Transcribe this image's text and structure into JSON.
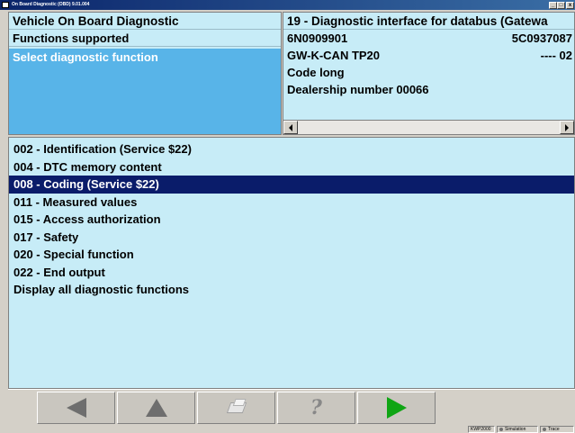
{
  "window": {
    "title": "On Board Diagnostic (OBD) 9.01.004",
    "min_label": "_",
    "max_label": "□",
    "close_label": "x"
  },
  "left_panel": {
    "title": "Vehicle On Board Diagnostic",
    "subtitle": "Functions supported",
    "selected": "Select diagnostic function"
  },
  "right_panel": {
    "title": "19 - Diagnostic interface for databus  (Gatewa",
    "rows": [
      {
        "left": "6N0909901",
        "right": "5C0937087"
      },
      {
        "left": "GW-K-CAN TP20",
        "right": "----  02"
      },
      {
        "left": "Code long",
        "right": ""
      },
      {
        "left": "Dealership number 00066",
        "right": ""
      }
    ]
  },
  "functions": {
    "items": [
      "002 - Identification (Service $22)",
      "004 - DTC memory content",
      "008 - Coding (Service $22)",
      "011 - Measured values",
      "015 - Access authorization",
      "017 - Safety",
      "020 - Special function",
      "022 - End output",
      "Display all diagnostic functions"
    ],
    "selected_index": 2
  },
  "toolbar": {
    "buttons": [
      "back-arrow-icon",
      "up-arrow-icon",
      "print-icon",
      "help-icon",
      "forward-arrow-icon"
    ],
    "help_glyph": "?"
  },
  "statusbar": {
    "protocol": "KWP2000",
    "simulation": "Simulation",
    "trace": "Trace"
  },
  "colors": {
    "panel_bg": "#c7ecf7",
    "selected_block": "#58b4e8",
    "selected_row": "#0a1c6a",
    "forward_green": "#0fa514"
  }
}
